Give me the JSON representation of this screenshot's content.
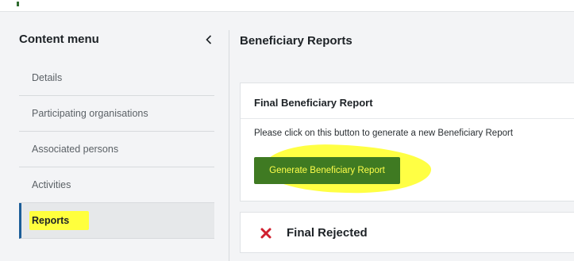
{
  "sidebar": {
    "title": "Content menu",
    "collapse_icon": "chevron-left-icon",
    "items": [
      {
        "label": "Details"
      },
      {
        "label": "Participating organisations"
      },
      {
        "label": "Associated persons"
      },
      {
        "label": "Activities"
      },
      {
        "label": "Reports"
      }
    ]
  },
  "main": {
    "title": "Beneficiary Reports",
    "report_card": {
      "title": "Final Beneficiary Report",
      "text": "Please click on this button to generate a new Beneficiary Report",
      "button_label": "Generate Beneficiary Report"
    },
    "status_card": {
      "icon": "close-icon",
      "label": "Final Rejected"
    }
  },
  "colors": {
    "accent_blue": "#1b5d98",
    "button_green": "#3f7a22",
    "highlight_yellow": "#ffff3d",
    "reject_red": "#d0202f"
  }
}
